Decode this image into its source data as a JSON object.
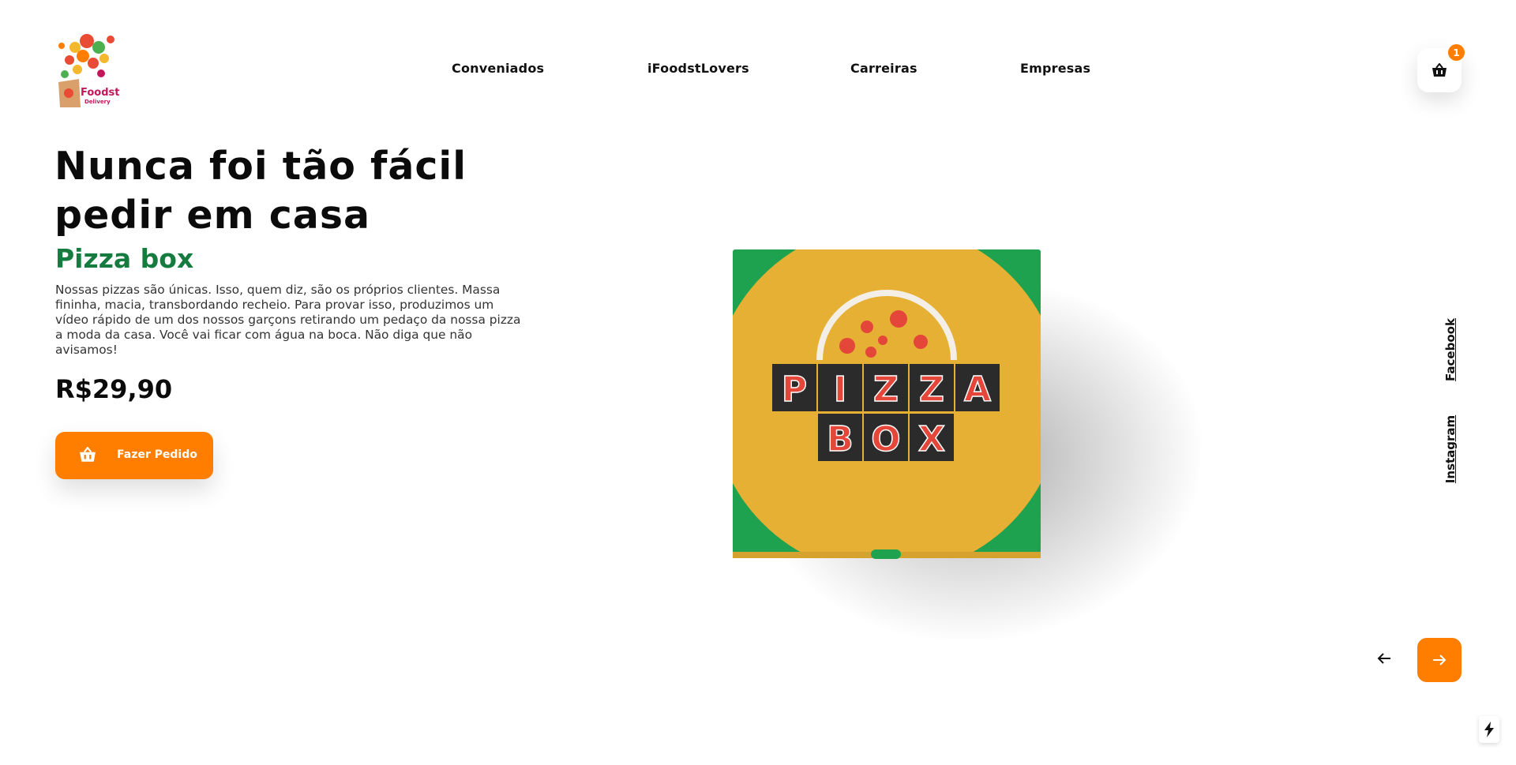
{
  "header": {
    "logo": {
      "brand": "Foodst",
      "tagline": "Delivery"
    },
    "nav": [
      "Conveniados",
      "iFoodstLovers",
      "Carreiras",
      "Empresas"
    ],
    "cart": {
      "icon": "basket-icon",
      "count": "1"
    }
  },
  "hero": {
    "title": "Nunca foi tão fácil pedir em casa",
    "product_name": "Pizza box",
    "description": "Nossas pizzas são únicas. Isso, quem diz, são os próprios clientes. Massa fininha, macia, transbordando recheio. Para provar isso, produzimos um vídeo rápido de um dos nossos garçons retirando um pedaço da nossa pizza a moda da casa. Você vai ficar com água na boca. Não diga que não avisamos!",
    "price": "R$29,90",
    "order_button": {
      "label": "Fazer Pedido",
      "icon": "basket-icon"
    }
  },
  "product_image": {
    "box_text": [
      "PIZZA",
      "BOX"
    ]
  },
  "social": [
    "Facebook",
    "Instagram"
  ],
  "carousel": {
    "prev_icon": "arrow-left-icon",
    "next_icon": "arrow-right-icon"
  },
  "colors": {
    "accent": "#ff7e00",
    "product_green": "#167b3f",
    "box_green": "#1fa24f",
    "box_yellow": "#e6b034"
  }
}
